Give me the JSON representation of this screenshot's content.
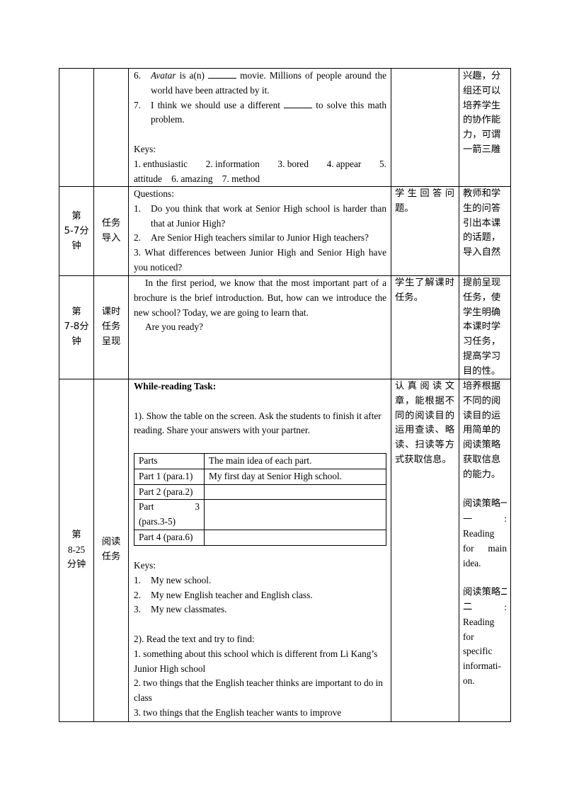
{
  "rows": [
    {
      "time": "",
      "stage": "",
      "activity": {
        "items": [
          {
            "num": "6.",
            "pre_italic": "Avatar",
            "text_a": " is a(n) ",
            "text_b": " movie. Millions of people around the world have been attracted by it."
          },
          {
            "num": "7.",
            "text_a": "I think we should use a different ",
            "text_b": " to solve this math problem."
          }
        ],
        "keys_label": "Keys:",
        "keys_line1": [
          "1. enthusiastic",
          "2. information",
          "3. bored",
          "4. appear",
          "5."
        ],
        "keys_line2": "attitude    6. amazing    7. method"
      },
      "student": "",
      "purpose": "兴趣，分组还可以培养学生的协作能力，可谓一箭三雕"
    },
    {
      "time": [
        "第",
        "5-7分",
        "钟"
      ],
      "stage": [
        "任务",
        "导入"
      ],
      "activity": {
        "label": "Questions:",
        "q1_num": "1.",
        "q1": "Do you think that work at Senior High school is harder than that at Junior High?",
        "q2_num": "2.",
        "q2": " Are Senior High teachers similar to Junior High teachers?",
        "q3": "3. What differences between Junior High and Senior High have you noticed?"
      },
      "student": "学生回答问题。",
      "purpose": "教师和学生的问答引出本课的话题，导入自然"
    },
    {
      "time": [
        "第",
        "7-8分",
        "钟"
      ],
      "stage": [
        "课时",
        "任务",
        "呈现"
      ],
      "activity": {
        "p1": "In the first period, we know that the most important part of a brochure is the brief introduction. But, how can we introduce the new school? Today, we are going to learn that.",
        "p2": "Are you ready?"
      },
      "student": "学生了解课时任务。",
      "purpose": "提前呈现任务，使学生明确本课时学习任务，提高学习目的性。"
    },
    {
      "time": [
        "第",
        "8-25",
        "分钟"
      ],
      "stage": [
        "阅读",
        "任务"
      ],
      "activity": {
        "title": "While-reading Task:",
        "task1": "1). Show the table on the screen. Ask the students to finish it after reading. Share your answers with your partner.",
        "table": {
          "headers": [
            "Parts",
            "The main idea of each part."
          ],
          "rows": [
            [
              "Part 1 (para.1)",
              "My first day at Senior High school."
            ],
            [
              "Part 2 (para.2)",
              ""
            ],
            [
              "Part 3 (pars.3-5)",
              ""
            ],
            [
              "Part 4 (para.6)",
              ""
            ]
          ],
          "part3_a": "Part",
          "part3_b": "3",
          "part3_c": "(pars.3-5)"
        },
        "keys_label": "Keys:",
        "keys": [
          {
            "num": "1.",
            "text": "My new school."
          },
          {
            "num": "2.",
            "text": "My new English teacher and English class."
          },
          {
            "num": "3.",
            "text": "My new classmates."
          }
        ],
        "task2": "2). Read the text and try to find:",
        "find": [
          "1. something about this school which is different from Li Kang’s Junior High school",
          "2. two things that the English teacher thinks are important to do in class",
          "3. two things that the English teacher wants to improve"
        ]
      },
      "student": "认真阅读文章，能根据不同的阅读目的运用查读、略读、扫读等方式获取信息。",
      "purpose": {
        "main": "培养根据不同的阅读目的运用简单的阅读策略获取信息的能力。",
        "s1_cn": "阅读策略一",
        "s1_colon": ":",
        "s1_en_a": "Reading",
        "s1_en_b1": "for",
        "s1_en_b2": "main",
        "s1_en_c": "idea.",
        "s2_cn": "阅读策略二",
        "s2_colon": ":",
        "s2_en": [
          "Reading",
          "for",
          "specific",
          "informati-",
          "on."
        ]
      }
    }
  ]
}
